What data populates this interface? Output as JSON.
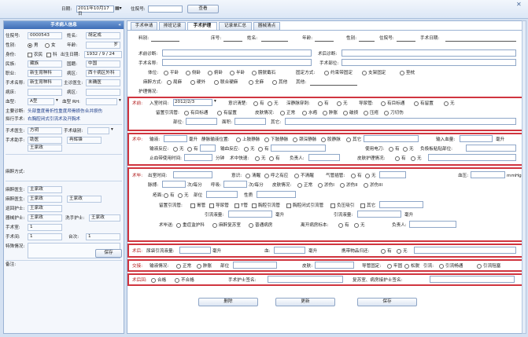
{
  "top": {
    "date_label": "日期:",
    "date_value": "2011年10月17日",
    "search_label": "住院号:",
    "search_btn": "查看"
  },
  "left": {
    "title": "手术病人信息",
    "rows": [
      {
        "label": "住院号:",
        "value": "0000543",
        "label2": "姓名:",
        "value2": "胡定成"
      },
      {
        "label": "性别:",
        "r1": "男",
        "r2": "女",
        "label2": "年龄:",
        "value2": "岁"
      },
      {
        "label": "身份:",
        "c1": "农民",
        "c2": "科",
        "label2": "出生日期:",
        "value2": "1932 / 9 / 24"
      },
      {
        "label": "民族:",
        "value": "藏族",
        "label2": "国籍:",
        "value2": "中国"
      },
      {
        "label": "职业:",
        "value": "新生育种科",
        "label2": "病区:",
        "value2": "西十病区外科"
      },
      {
        "label": "手术名称:",
        "value": "新生育种科",
        "label2": "主诊医生:",
        "value2": "未确医"
      },
      {
        "label": "病床:",
        "value": "",
        "label2": "病区:",
        "value2": ""
      },
      {
        "label": "血型:",
        "value": "A型",
        "label2": "血型 RH:",
        "value2": ""
      }
    ],
    "diag_label": "主要诊断:",
    "diag_value": "头部重度骨折性重度颅骨损伤合并损伤",
    "surg_label": "拟行手术:",
    "surg_value": "右胸腔闭式引流术及开胸术",
    "doc_label": "手术医生:",
    "doc_value": "方玥",
    "level_label": "手术级别:",
    "assist_label": "手术助手:",
    "assist1": "助医",
    "assist2": "冉辉锋",
    "assist3": "王家政",
    "anes_label": "麻醉方式:",
    "rows2": [
      {
        "label": "麻醉医生:",
        "value": "主家政"
      },
      {
        "label": "麻醉医生:",
        "value": "王家政",
        "value2": "王家政"
      },
      {
        "label": "巡回护士:",
        "value": "王家政"
      },
      {
        "label": "器械护士:",
        "value": "王家政",
        "label2": "洗手护士:",
        "value2": "王家政"
      },
      {
        "label": "手术室:",
        "value": "1"
      },
      {
        "label": "手术间:",
        "value": "1",
        "label2": "台次:",
        "value2": "1"
      }
    ],
    "special_label": "特殊情况:",
    "note_label": "备注:",
    "save_btn": "保存"
  },
  "tabs": [
    "手术申请",
    "排班记录",
    "手术护理",
    "记录单汇总",
    "器械清点"
  ],
  "hdr": {
    "no": "料别:",
    "bed": "床号:",
    "name": "姓名:",
    "age": "年龄:",
    "sex": "性别:",
    "inpatient": "住院号:",
    "surgery_date": "手术日期:"
  },
  "pre": {
    "pre_diag": "术前诊断:",
    "post_diag": "术后诊断:",
    "surg_name": "手术名称:",
    "anes": "手术部位:"
  },
  "pos": {
    "label": "体位:",
    "opts": [
      "平卧",
      "侧卧",
      "俯卧",
      "半卧",
      "膀胱截石",
      "固定方式:",
      "约束带固定",
      "支架固定",
      "垫枕"
    ]
  },
  "anesth": {
    "label": "麻醉方式:",
    "opts": [
      "局麻",
      "硬外",
      "联合硬麻",
      "全麻",
      "其他",
      "其他:"
    ]
  },
  "nurse_label": "护理情况:",
  "s1": {
    "tag": "术前:",
    "time_label": "入室时间:",
    "time": "2012/2/3",
    "conscious": "意识清楚:",
    "yes": "有",
    "no": "无",
    "bl": "深静脉穿刺:",
    "cath": "导尿管:",
    "sz": "有目标通",
    "sz2": "有留置",
    "ind": "留置引流管:",
    "p1": "有目标通",
    "p2": "有留置",
    "skin": "皮肤情况:",
    "s1": "正常",
    "s2": "水疱",
    "s3": "肿胀",
    "s4": "破损",
    "s5": "压疮",
    "s6": "刀切伤",
    "part": "部位:",
    "area": "面积:",
    "other": "其它:"
  },
  "s2": {
    "tag": "术中:",
    "inf": "输液:",
    "unit": "毫升",
    "v1": "静脉输液位置:",
    "v2": "上肢静脉",
    "v3": "下肢静脉",
    "v4": "颈深静脉",
    "v5": "股静脉",
    "v6": "其它",
    "v7": "输入血量:",
    "v8": "毫升",
    "react": "输液反应:",
    "yes": "有",
    "no": "无",
    "btr": "输血反应:",
    "elec": "使用电刀:",
    "neg": "负极板粘贴部位:",
    "tourn": "止血带使用时间:",
    "min": "分钟",
    "ttype": "术中快速:",
    "res": "负责人:",
    "skin2": "皮肤护理情况:"
  },
  "s3": {
    "tag": "术毕:",
    "exit": "出室时间:",
    "consc": "意识:",
    "c1": "清醒",
    "c2": "呼之有应",
    "c3": "不清醒",
    "tube": "气管插管:",
    "yes": "有",
    "no": "无",
    "bp": "血压:",
    "bpu": "mmHg",
    "pulse": "脉搏:",
    "pu": "次/每分",
    "resp": "呼吸:",
    "ru": "次/每分",
    "skin": "皮肤情况:",
    "n": "正常",
    "sk1": "淤伤I",
    "sk2": "淤伤II",
    "sk3": "淤伤III",
    "wound": "疮面:",
    "part": "部位",
    "nature": "性质",
    "drain": "留置引流管:",
    "d1": "胃管",
    "d2": "导尿管",
    "d3": "T管",
    "d4": "胸腔引流管",
    "d5": "胸腔闭式引流管",
    "d6": "负压吸引",
    "d7": "其它",
    "drainvol": "引流液量:",
    "ml": "毫升",
    "drainvol2": "引流液量:",
    "transfer": "术毕送:",
    "t1": "重症监护科",
    "t2": "麻醉复苏室",
    "t3": "普通病房",
    "tl": "离开病房标本:",
    "res": "负责人:"
  },
  "s4": {
    "tag": "术后:",
    "urine": "尿袋引流液量:",
    "ml": "毫升",
    "blood": "血:",
    "mlb": "毫升",
    "item": "携带物品归还:",
    "yes": "有",
    "no": "无"
  },
  "s5": {
    "tag": "交接:",
    "check": "输液情况:",
    "ok": "正常",
    "bad": "肿胀",
    "part": "部位",
    "mark": "皮肤:",
    "tube": "导管固定:",
    "a1": "牢固",
    "a2": "松脱",
    "ind": "引流:",
    "b1": "引流畅通",
    "b2": "引流阻塞"
  },
  "s6": {
    "tag": "术后回:",
    "ok": "合格",
    "bad": "不合格",
    "sign": "手术护士签名:",
    "sign2": "复苏室、病房接护士签名:"
  },
  "btns": {
    "del": "删除",
    "upd": "更新",
    "save": "保存"
  }
}
